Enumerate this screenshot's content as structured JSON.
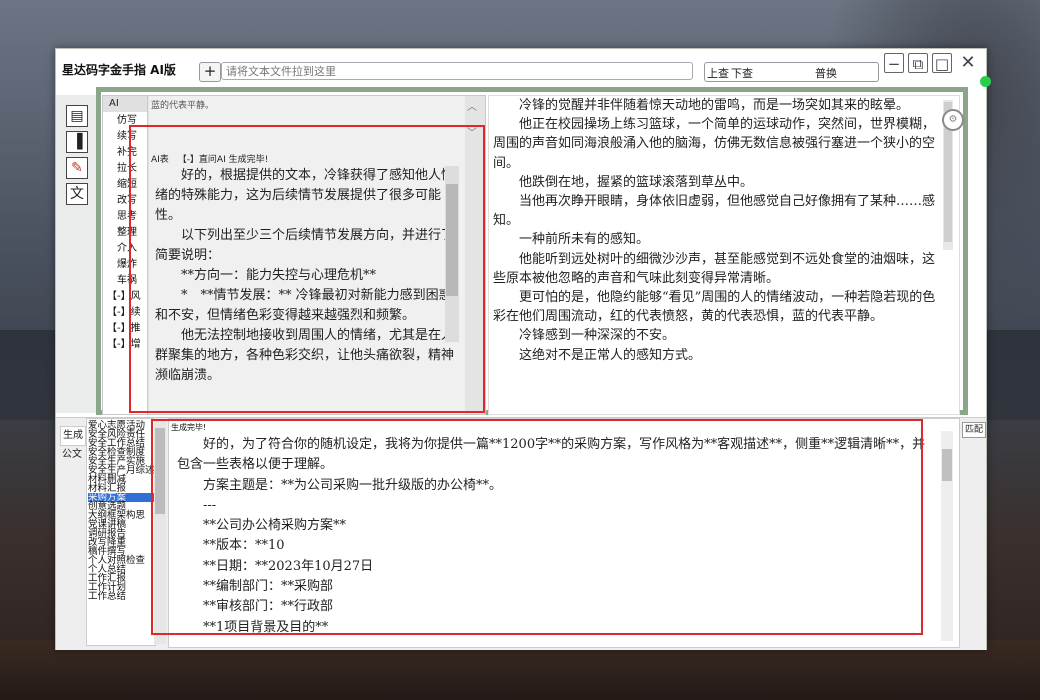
{
  "app": {
    "title": "星达码字金手指 AI版"
  },
  "toolbar": {
    "add_label": "+",
    "drop_placeholder": "请将文本文件拉到这里",
    "search_prev": "上查",
    "search_next": "下查",
    "search_replace": "普换"
  },
  "left_icons": [
    {
      "name": "save-icon",
      "glyph": "💾"
    },
    {
      "name": "panel-icon",
      "glyph": "▌"
    },
    {
      "name": "notes-icon",
      "glyph": "📝"
    },
    {
      "name": "text-icon",
      "glyph": "文"
    }
  ],
  "ai_panel": {
    "tab_label": "AI",
    "items": [
      "仿写",
      "续写",
      "补完",
      "拉长",
      "缩短",
      "改写",
      "思考",
      "整理",
      "介入",
      "爆炸",
      "车祸",
      "【-】风",
      "【-】续",
      "【-】推",
      "【-】增"
    ],
    "hint": "蓝的代表平静。",
    "status_label": "AI表",
    "status_text": "【-】直问AI 生成完毕!",
    "paragraphs": [
      "好的，根据提供的文本，冷锋获得了感知他人情绪的特殊能力，这为后续情节发展提供了很多可能性。",
      "以下列出至少三个后续情节发展方向，并进行了简要说明：",
      "**方向一：能力失控与心理危机**",
      "*　**情节发展：** 冷锋最初对新能力感到困惑和不安，但情绪色彩变得越来越强烈和频繁。",
      "他无法控制地接收到周围人的情绪，尤其是在人群聚集的地方，各种色彩交织，让他头痛欲裂，精神濒临崩溃。"
    ]
  },
  "document": {
    "paragraphs": [
      "冷锋的觉醒并非伴随着惊天动地的雷鸣，而是一场突如其来的眩晕。",
      "他正在校园操场上练习篮球，一个简单的运球动作，突然间，世界模糊，周围的声音如同海浪般涌入他的脑海，仿佛无数信息被强行塞进一个狭小的空间。",
      "他跌倒在地，握紧的篮球滚落到草丛中。",
      "当他再次睁开眼睛，身体依旧虚弱，但他感觉自己好像拥有了某种……感知。",
      "一种前所未有的感知。",
      "他能听到远处树叶的细微沙沙声，甚至能感觉到不远处食堂的油烟味，这些原本被他忽略的声音和气味此刻变得异常清晰。",
      "更可怕的是，他隐约能够“看见”周围的人的情绪波动，一种若隐若现的色彩在他们周围流动，红的代表愤怒，黄的代表恐惧，蓝的代表平静。",
      "冷锋感到一种深深的不安。",
      "这绝对不是正常人的感知方式。"
    ]
  },
  "bottom": {
    "tabs": [
      "生成",
      "公文"
    ],
    "match_label": "匹配",
    "list_items": [
      "爱心志愿活动",
      "安全风险责任",
      "安全工作总结",
      "安全检查制度",
      "安全生产实施",
      "安全生产月综述",
      "材料删减",
      "材料汇报",
      "采购方案",
      "创意选题",
      "大纲框架构思",
      "党课讲稿",
      "调研报告",
      "改写降重",
      "稿件撰写",
      "个人对照检查",
      "个人总结",
      "工作汇报",
      "工作计划",
      "工作总结"
    ],
    "selected_index": 8,
    "status_text": "生成完毕!",
    "paragraphs": [
      "好的，为了符合你的随机设定，我将为你提供一篇**1200字**的采购方案，写作风格为**客观描述**，侧重**逻辑清晰**，并包含一些表格以便于理解。",
      "方案主题是：**为公司采购一批升级版的办公椅**。",
      "---",
      "**公司办公椅采购方案**",
      "**版本：**10",
      "**日期：**2023年10月27日",
      "**编制部门：**采购部",
      "**审核部门：**行政部",
      "**1项目背景及目的**"
    ]
  }
}
